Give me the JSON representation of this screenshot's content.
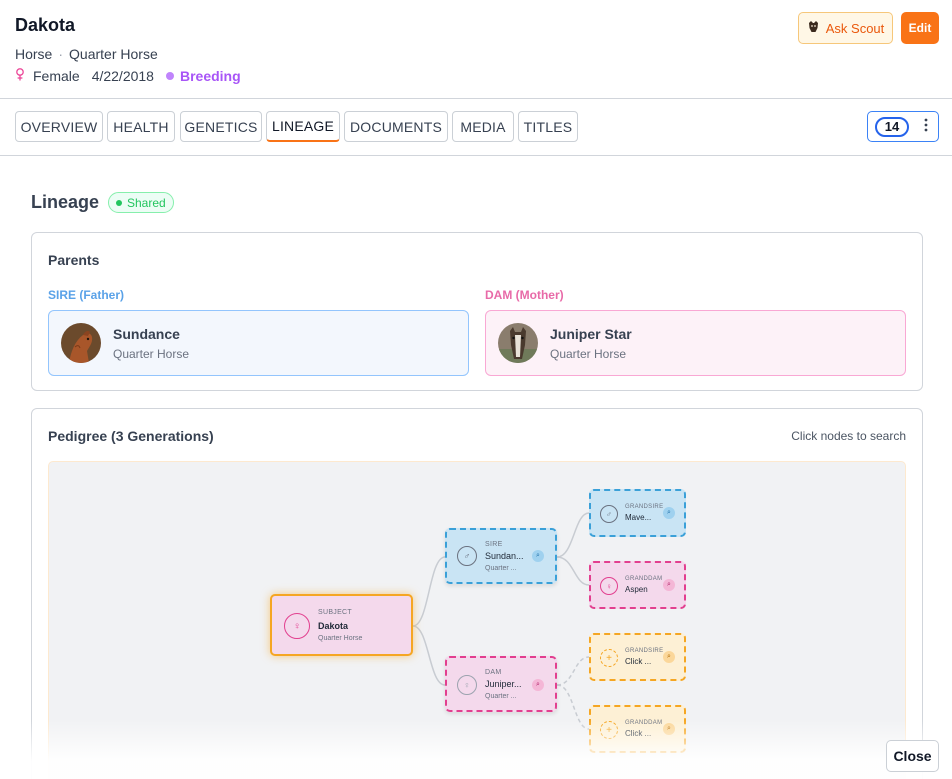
{
  "header": {
    "title": "Dakota",
    "species": "Horse",
    "separator": "·",
    "breed": "Quarter Horse",
    "sex_icon": "female-symbol-icon",
    "sex": "Female",
    "dob": "4/22/2018",
    "status": "Breeding",
    "ask_label": "Ask Scout",
    "edit_label": "Edit"
  },
  "tabs": [
    {
      "label": "OVERVIEW"
    },
    {
      "label": "HEALTH"
    },
    {
      "label": "GENETICS"
    },
    {
      "label": "LINEAGE",
      "active": true
    },
    {
      "label": "DOCUMENTS"
    },
    {
      "label": "MEDIA"
    },
    {
      "label": "TITLES"
    }
  ],
  "badge_count": "14",
  "lineage": {
    "title": "Lineage",
    "shared_label": "Shared",
    "parents": {
      "title": "Parents",
      "sire_label": "SIRE (Father)",
      "dam_label": "DAM (Mother)",
      "sire": {
        "name": "Sundance",
        "breed": "Quarter Horse"
      },
      "dam": {
        "name": "Juniper Star",
        "breed": "Quarter Horse"
      }
    },
    "pedigree": {
      "title": "Pedigree (3 Generations)",
      "hint": "Click nodes to search",
      "nodes": {
        "subject": {
          "role": "SUBJECT",
          "name": "Dakota",
          "breed": "Quarter Horse"
        },
        "sire": {
          "role": "SIRE",
          "name": "Sundan...",
          "breed": "Quarter ..."
        },
        "dam": {
          "role": "DAM",
          "name": "Juniper...",
          "breed": "Quarter ..."
        },
        "grandsire_paternal": {
          "role": "GRANDSIRE",
          "name": "Mave..."
        },
        "granddam_paternal": {
          "role": "GRANDDAM",
          "name": "Aspen"
        },
        "grandsire_maternal": {
          "role": "GRANDSIRE",
          "name": "Click ..."
        },
        "granddam_maternal": {
          "role": "GRANDDAM",
          "name": "Click ..."
        }
      }
    }
  },
  "footer": {
    "close_label": "Close"
  },
  "colors": {
    "accent": "#f97316",
    "sire": "#3b82f6",
    "dam": "#ec4899",
    "status": "#a855f7",
    "shared": "#22c55e"
  }
}
